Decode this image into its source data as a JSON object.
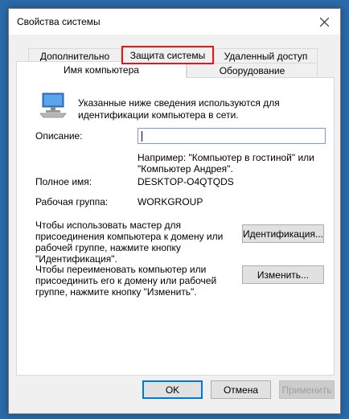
{
  "window": {
    "title": "Свойства системы",
    "close_label": "✕"
  },
  "tabs_row1": [
    {
      "label": "Дополнительно"
    },
    {
      "label": "Защита системы",
      "highlighted": true
    },
    {
      "label": "Удаленный доступ"
    }
  ],
  "tabs_row2": [
    {
      "label": "Имя компьютера",
      "active": true
    },
    {
      "label": "Оборудование"
    }
  ],
  "computer_name_tab": {
    "intro_line1": "Указанные ниже сведения используются для",
    "intro_line2": "идентификации компьютера в сети.",
    "description_label": "Описание:",
    "description_value": "",
    "example_line1": "Например: \"Компьютер в гостиной\" или",
    "example_line2": "\"Компьютер Андрея\".",
    "full_name_label": "Полное имя:",
    "full_name_value": "DESKTOP-O4QTQDS",
    "workgroup_label": "Рабочая группа:",
    "workgroup_value": "WORKGROUP",
    "id_text_line1": "Чтобы использовать мастер для",
    "id_text_line2": "присоединения компьютера к домену или",
    "id_text_line3": "рабочей группе, нажмите кнопку",
    "id_text_line4": "\"Идентификация\".",
    "id_button": "Идентификация...",
    "rename_text_line1": "Чтобы переименовать компьютер или",
    "rename_text_line2": "присоединить его к домену или рабочей",
    "rename_text_line3": "группе, нажмите кнопку \"Изменить\".",
    "rename_button": "Изменить..."
  },
  "footer": {
    "ok": "OK",
    "cancel": "Отмена",
    "apply": "Применить"
  },
  "colors": {
    "highlight_border": "#e8161c",
    "focus_border": "#0078d7"
  }
}
